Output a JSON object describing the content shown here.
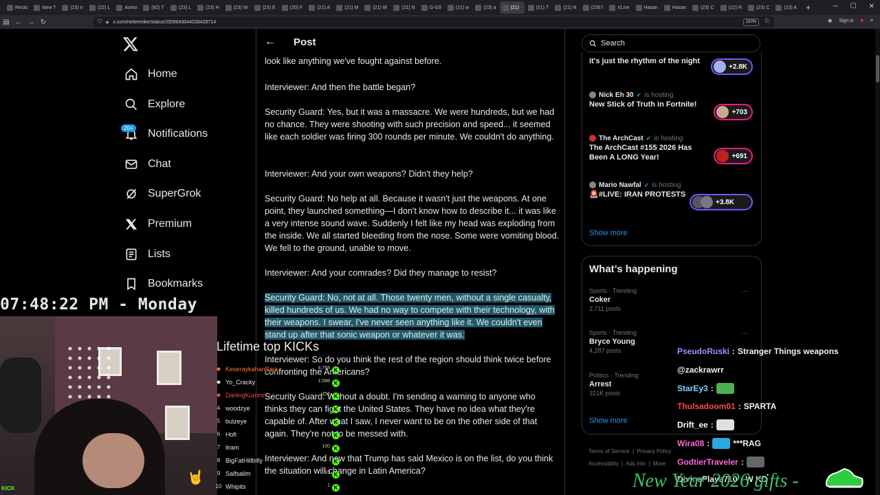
{
  "browser": {
    "tabs": [
      "Resto",
      "New T",
      "(23) Ir",
      "(22) L",
      "Asmo",
      "(82) T",
      "(23) L",
      "(23) H",
      "(23) W",
      "(23) E",
      "(20) F",
      "(21) A",
      "(21) M",
      "(21) W",
      "(21) N",
      "G-G9",
      "(21) w",
      "(23) a",
      "(21)",
      "(21) T",
      "(21) N",
      "(2357",
      "r/Live",
      "Hasan",
      "Hasan",
      "(23) C",
      "(22) R",
      "(23) C",
      "(23) A"
    ],
    "active_tab_index": 18,
    "url": "x.com/nettermike/status/2009843044028428714",
    "zoom": "150%",
    "sign_in": "Sign in"
  },
  "nav": {
    "items": [
      {
        "label": "Home",
        "icon": "home-icon"
      },
      {
        "label": "Explore",
        "icon": "search-icon"
      },
      {
        "label": "Notifications",
        "icon": "bell-icon",
        "badge": "20+"
      },
      {
        "label": "Chat",
        "icon": "mail-icon"
      },
      {
        "label": "SuperGrok",
        "icon": "grok-icon"
      },
      {
        "label": "Premium",
        "icon": "x-icon"
      },
      {
        "label": "Lists",
        "icon": "list-icon"
      },
      {
        "label": "Bookmarks",
        "icon": "bookmark-icon"
      }
    ]
  },
  "post": {
    "header_title": "Post",
    "paragraphs": [
      "look like anything we've fought against before.",
      "Interviewer: And then the battle began?",
      "Security Guard: Yes, but it was a massacre. We were hundreds, but we had no chance. They were shooting with such precision and speed... it seemed like each soldier was firing 300 rounds per minute. We couldn't do anything.",
      "Interviewer: And your own weapons? Didn't they help?",
      "Security Guard: No help at all. Because it wasn't just the weapons. At one point, they launched something—I don't know how to describe it... it was like a very intense sound wave. Suddenly I felt like my head was exploding from the inside. We all started bleeding from the nose. Some were vomiting blood. We fell to the ground, unable to move.",
      "Interviewer: And your comrades? Did they manage to resist?",
      "Security Guard: No, not at all. Those twenty men, without a single casualty, killed hundreds of us. We had no way to compete with their technology, with their weapons. I swear, I've never seen anything like it. We couldn't even stand up after that sonic weapon or whatever it was.",
      "Interviewer: So do you think the rest of the region should think twice before confronting the Americans?",
      "Security Guard: Without a doubt. I'm sending a warning to anyone who thinks they can fight the United States. They have no idea what they're capable of. After what I saw, I never want to be on the other side of that again. They're not to be messed with.",
      "Interviewer: And now that Trump has said Mexico is on the list, do you think the situation will change in Latin America?"
    ]
  },
  "sidebar": {
    "search_placeholder": "Search",
    "live": [
      {
        "host": "",
        "hosting": "",
        "title": "it's just the rhythm of the night",
        "count": "+2.8K"
      },
      {
        "host": "Nick Eh 30",
        "hosting": "is hosting",
        "title": "New Stick of Truth in Fortnite!",
        "count": "+703"
      },
      {
        "host": "The ArchCast",
        "hosting": "is hosting",
        "title": "The ArchCast #155 2026 Has Been A LONG Year!",
        "count": "+691"
      },
      {
        "host": "Mario Nawfal",
        "hosting": "is hosting",
        "title": "🚨#LIVE: IRAN PROTESTS",
        "count": "+3.8K"
      }
    ],
    "show_more": "Show more",
    "happening_title": "What’s happening",
    "trends": [
      {
        "category": "Sports · Trending",
        "name": "Coker",
        "count": "2,711 posts"
      },
      {
        "category": "Sports · Trending",
        "name": "Bryce Young",
        "count": "4,287 posts"
      },
      {
        "category": "Politics · Trending",
        "name": "Arrest",
        "count": "321K posts"
      }
    ],
    "show_more_2": "Show more",
    "footer": [
      "Terms of Service",
      "Privacy Policy",
      "Accessibility",
      "Ads info",
      "More"
    ]
  },
  "stream": {
    "clock": "07:48:22 PM - Monday",
    "kick_tag": "KICK",
    "kicks_title": "Lifetime top KICKs",
    "kicks": [
      {
        "rank": "◆",
        "name": "KeseraykahanRaja",
        "value": "4,768",
        "color": "#ff7a2b"
      },
      {
        "rank": "◆",
        "name": "Yo_Cracky",
        "value": "1,588",
        "color": "#e8e8e8"
      },
      {
        "rank": "◆",
        "name": "DarlingKuromi",
        "value": "756",
        "color": "#ff4a4a"
      },
      {
        "rank": "4",
        "name": "woodzye",
        "value": "",
        "color": "#e8e8e8"
      },
      {
        "rank": "5",
        "name": "bulzeye",
        "value": "",
        "color": "#e8e8e8"
      },
      {
        "rank": "6",
        "name": "Hofi",
        "value": "",
        "color": "#e8e8e8"
      },
      {
        "rank": "7",
        "name": "liram",
        "value": "100",
        "color": "#e8e8e8"
      },
      {
        "rank": "8",
        "name": "BigFatHillbilly",
        "value": "",
        "color": "#e8e8e8"
      },
      {
        "rank": "9",
        "name": "Salfsalim",
        "value": "10",
        "color": "#e8e8e8"
      },
      {
        "rank": "10",
        "name": "Whipits",
        "value": "1",
        "color": "#e8e8e8"
      }
    ],
    "chat": [
      {
        "user": "PseudoRuski",
        "text": "Stranger Things weapons",
        "color": "#a58cff",
        "emote": ""
      },
      {
        "user": "",
        "text": "@zackrawrr",
        "color": "#ffffff",
        "emote": ""
      },
      {
        "user": "StarEy3",
        "text": "",
        "color": "#7fd4ff",
        "emote": "#4caf50"
      },
      {
        "user": "Thulsadoom01",
        "text": "SPARTA",
        "color": "#ff4a4a",
        "emote": ""
      },
      {
        "user": "Drift_ee",
        "text": "",
        "color": "#ffffff",
        "emote": "#e0e0e0"
      },
      {
        "user": "Wira08",
        "text": "***RAG",
        "color": "#ff6ad5",
        "emote": "#2aa9e0"
      },
      {
        "user": "GodtierTraveler",
        "text": "",
        "color": "#ff6ad5",
        "emote": "#666666"
      },
      {
        "user": "DivinePlaya710",
        "text": "W KD",
        "color": "#f2f2f2",
        "emote": ""
      }
    ],
    "gifts_text": "New Year 2026 gifts -"
  },
  "colors": {
    "accent": "#1d9bf0",
    "kick_green": "#53fc18",
    "pill_pink": "#f91880",
    "pill_purple": "#7856ff",
    "highlight": "#1f5a6a"
  }
}
